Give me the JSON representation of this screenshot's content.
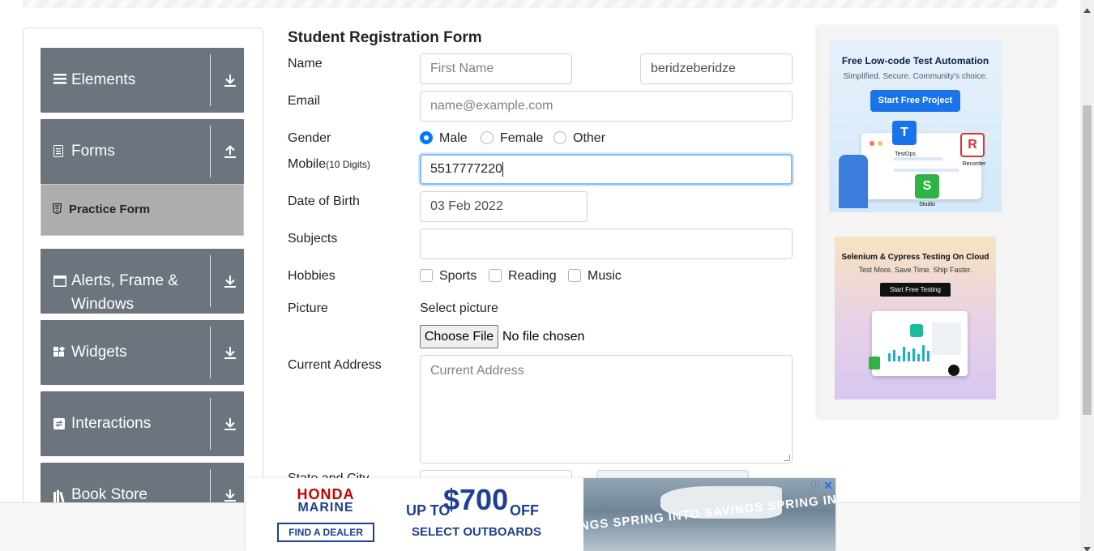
{
  "sidebar": {
    "groups": [
      {
        "label": "Elements",
        "icon": "menu-icon",
        "arrow": "down-arrow-icon"
      },
      {
        "label": "Forms",
        "icon": "document-icon",
        "arrow": "up-arrow-icon"
      },
      {
        "label": "Alerts, Frame & Windows",
        "icon": "window-icon",
        "arrow": "down-arrow-icon"
      },
      {
        "label": "Widgets",
        "icon": "widgets-icon",
        "arrow": "down-arrow-icon"
      },
      {
        "label": "Interactions",
        "icon": "interactions-icon",
        "arrow": "down-arrow-icon"
      },
      {
        "label": "Book Store",
        "icon": "books-icon",
        "arrow": "down-arrow-icon"
      }
    ],
    "active_item": "Practice Form"
  },
  "form": {
    "title": "Student Registration Form",
    "name_label": "Name",
    "first_name_placeholder": "First Name",
    "last_name_value": "beridzeberidze",
    "email_label": "Email",
    "email_placeholder": "name@example.com",
    "gender_label": "Gender",
    "gender_options": [
      "Male",
      "Female",
      "Other"
    ],
    "gender_selected": "Male",
    "mobile_label": "Mobile",
    "mobile_hint": "(10 Digits)",
    "mobile_value": "5517777220",
    "dob_label": "Date of Birth",
    "dob_value": "03 Feb 2022",
    "subjects_label": "Subjects",
    "hobbies_label": "Hobbies",
    "hobbies": [
      "Sports",
      "Reading",
      "Music"
    ],
    "picture_label": "Picture",
    "select_picture": "Select picture",
    "choose_file": "Choose File",
    "no_file": "No file chosen",
    "address_label": "Current Address",
    "address_placeholder": "Current Address",
    "state_city_label": "State and City"
  },
  "ads": {
    "side1": {
      "title": "Free Low-code Test Automation",
      "subtitle": "Simplified. Secure. Community's choice.",
      "button": "Start Free Project",
      "products": [
        "TestOps",
        "Recorder",
        "Studio"
      ]
    },
    "side2": {
      "title": "Selenium & Cypress Testing On Cloud",
      "subtitle": "Test More. Save Time. Ship Faster.",
      "button": "Start Free Testing"
    },
    "bottom": {
      "brand_top": "HONDA",
      "brand_bottom": "MARINE",
      "dealer_button": "FIND A DEALER",
      "offer_prefix": "UP TO",
      "offer_amount": "$700",
      "offer_suffix": "OFF",
      "offer_line2": "SELECT OUTBOARDS",
      "banner_text": "INGS  SPRING INTO SAVINGS  SPRING IN"
    }
  },
  "colors": {
    "sidebar_group": "#6c757d",
    "active_item_bg": "#adadad",
    "radio_selected": "#007bff",
    "ad_button_blue": "#1a73e8",
    "honda_red": "#cc0000",
    "honda_blue": "#1e3f95"
  }
}
